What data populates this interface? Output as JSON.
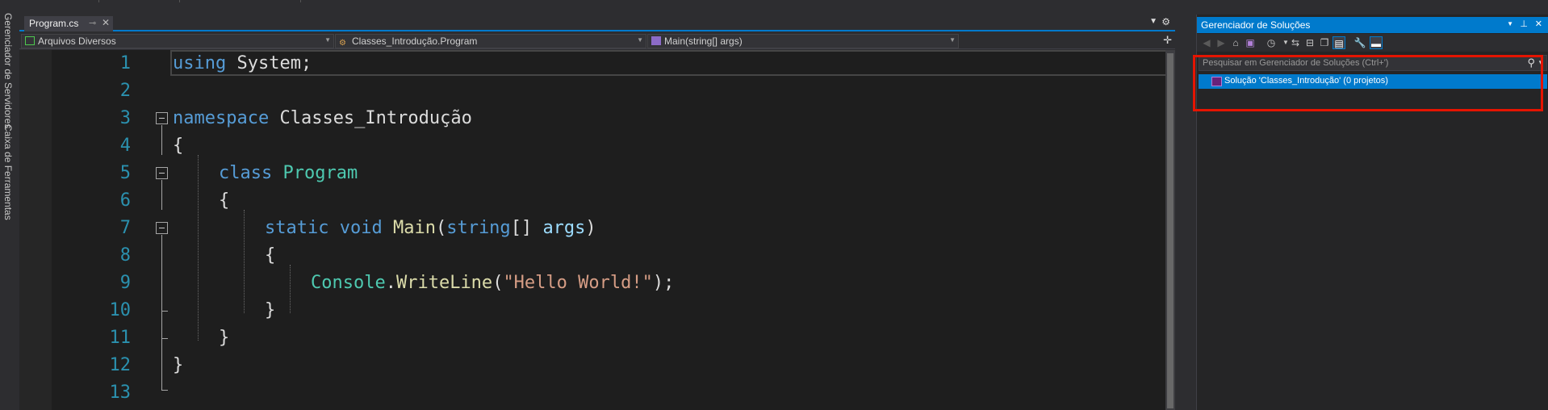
{
  "left_strip": {
    "server_explorer": "Gerenciador de Servidores",
    "toolbox": "Caixa de Ferramentas"
  },
  "tab": {
    "label": "Program.cs",
    "pin_icon": "pin-icon",
    "close_icon": "close-icon"
  },
  "navbar": {
    "project": "Arquivos Diversos",
    "class": "Classes_Introdução.Program",
    "member": "Main(string[] args)"
  },
  "code": {
    "line_numbers": [
      "1",
      "2",
      "3",
      "4",
      "5",
      "6",
      "7",
      "8",
      "9",
      "10",
      "11",
      "12",
      "13"
    ],
    "l1_kw": "using",
    "l1_rest": " System;",
    "l3_kw": "namespace",
    "l3_rest": " Classes_Introdução",
    "l4": "{",
    "l5_kw": "class",
    "l5_type": "Program",
    "l6": "{",
    "l7_kw1": "static",
    "l7_kw2": "void",
    "l7_method": "Main",
    "l7_open": "(",
    "l7_kw3": "string",
    "l7_brackets": "[] ",
    "l7_param": "args",
    "l7_close": ")",
    "l8": "{",
    "l9_type": "Console",
    "l9_dot": ".",
    "l9_method": "WriteLine",
    "l9_open": "(",
    "l9_str": "\"Hello World!\"",
    "l9_close": ");",
    "l10": "}",
    "l11": "}",
    "l12": "}"
  },
  "solution_explorer": {
    "title": "Gerenciador de Soluções",
    "search_placeholder": "Pesquisar em Gerenciador de Soluções (Ctrl+')",
    "solution_item": "Solução 'Classes_Introdução' (0 projetos)"
  },
  "colors": {
    "accent": "#007acc",
    "highlight_box": "#e51400",
    "keyword": "#569cd6",
    "type": "#4ec9b0",
    "string": "#d69d85"
  }
}
